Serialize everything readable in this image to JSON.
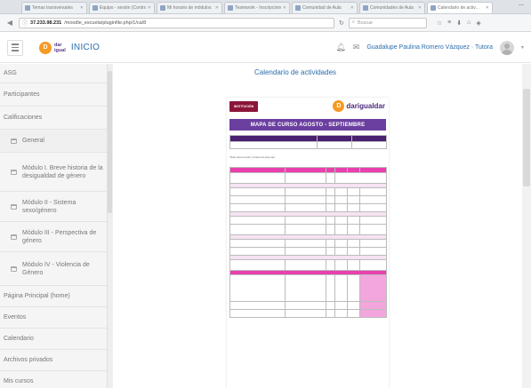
{
  "browser": {
    "tabs": [
      {
        "label": "Temas transversales"
      },
      {
        "label": "Equipo - sesión (Control)"
      },
      {
        "label": "Mi horario de módulos"
      },
      {
        "label": "Teamwork - Inscripciones"
      },
      {
        "label": "Comunidad de Aula"
      },
      {
        "label": "Comunidades de Aula"
      },
      {
        "label": "Calendario de activ..."
      }
    ],
    "url_host": "37.233.98.231",
    "url_path": "/moodle_escuela/pluginfile.php/1/ca/8",
    "search_placeholder": "Buscar"
  },
  "header": {
    "logo_letter": "D",
    "logo_text_1": "dar",
    "logo_text_2": "igual",
    "home_label": "INICIO",
    "user_name": "Guadalupe Paulina Romero Vázquez · Tutora"
  },
  "sidebar": {
    "items": [
      {
        "label": "ASG"
      },
      {
        "label": "Participantes"
      },
      {
        "label": "Calificaciones"
      },
      {
        "label": "General"
      },
      {
        "label": "Módulo I. Breve historia de la desigualdad de género"
      },
      {
        "label": "Módulo II - Sistema sexo/género"
      },
      {
        "label": "Módulo III - Perspectiva de género"
      },
      {
        "label": "Módulo IV - Violencia de Género"
      },
      {
        "label": "Página Principal (home)"
      },
      {
        "label": "Eventos"
      },
      {
        "label": "Calendario"
      },
      {
        "label": "Archivos privados"
      },
      {
        "label": "Mis cursos"
      }
    ]
  },
  "main": {
    "page_title": "Calendario de actividades",
    "doc": {
      "institution_label": "INSTITUCIÓN",
      "brand_letter": "D",
      "brand_text": "darigualdar",
      "banner_title": "MAPA DE CURSO AGOSTO - SEPTIEMBRE",
      "note": "*Notas sobre la sesión y horarios del grupo aquí"
    }
  },
  "colors": {
    "link_blue": "#2a6db0",
    "doc_purple": "#6b3fa0",
    "doc_pink": "#ea3fae",
    "logo_orange": "#f59a23"
  }
}
